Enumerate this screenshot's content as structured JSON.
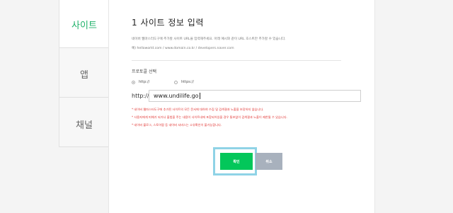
{
  "sidebar": {
    "items": [
      {
        "label": "사이트",
        "active": true
      },
      {
        "label": "앱",
        "active": false
      },
      {
        "label": "채널",
        "active": false
      }
    ]
  },
  "form": {
    "title": "1 사이트 정보 입력",
    "description": "네이버 웹마스터도구에 추가할 사이트 URL을 입력해주세요. 아래 예시와 같이 URL 호스트만 추가할 수 있습니다.",
    "example": "예) helloworld.com / www.domain.co.kr / developers.naver.com",
    "protocol_label": "프로토콜 선택",
    "protocols": [
      {
        "label": "http://",
        "selected": true
      },
      {
        "label": "https://",
        "selected": false
      }
    ],
    "url_prefix": "http://",
    "url_value": "www.undilife.go",
    "notes": [
      "* 네이버 웹마스터도구에 추가된 사이트의 모든 문서에 대하여 수집 및 검색결과 노출을 보장하지 않습니다.",
      "* 사용자에게 피해가 되거나 불법을 주는 내용이 사이트내에 포함되어있을 경우 통보없이 검색결과 노출이 제한될 수 있습니다.",
      "* 네이버 블로그, 스토어팜 등 네이버 서비스는 소유확인이 불가능합니다."
    ],
    "confirm_label": "확인",
    "cancel_label": "취소"
  },
  "colors": {
    "accent_green": "#03c75a",
    "active_tab_text": "#1fb26a",
    "note_red": "#e0322f",
    "highlight_border": "#8fd3e6",
    "cancel_gray": "#a8b1bd"
  }
}
